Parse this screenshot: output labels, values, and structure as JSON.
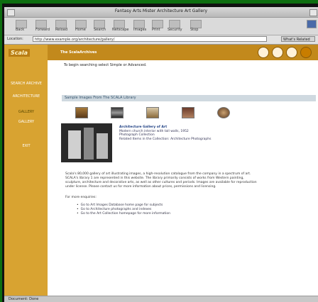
{
  "window": {
    "title": "Fantasy Arts  Mister Architecture  Art  Gallery"
  },
  "toolbar": {
    "buttons": [
      "Back",
      "Forward",
      "Reload",
      "Home",
      "Search",
      "Netscape",
      "Images",
      "Print",
      "Security",
      "Stop"
    ]
  },
  "location": {
    "label": "Location:",
    "url": "http://www.example.org/architecture/gallery/",
    "whats_related": "What's Related"
  },
  "sidebar": {
    "logo": "Scala",
    "links": [
      "SEARCH ARCHIVE",
      "ARCHITECTURE",
      "GALLERY",
      "EXIT"
    ],
    "active_index": 2
  },
  "header": {
    "section_title": "The ScalaArchives"
  },
  "page": {
    "intro": "To begin searching select Simple or Advanced.",
    "sample_title": "Sample Images From The SCALA Library",
    "feature": {
      "heading": "Architecture  Gallery of Art",
      "lines": [
        "Modern church interior with tall walls, 1952",
        "Photograph Collection",
        "Related Items in the Collection: Architecture Photographs"
      ]
    },
    "body": "Scala's 80,000 gallery of art illustrating images, a high-resolution catalogue from the company in a spectrum of art. SCALA's library 1 are represented in this website. The library primarily consists of works from Western painting, sculpture, architecture and decorative arts, as well as other cultures and periods. Images are available for reproduction under license. Please contact us for more information about prices, permissions and licensing.",
    "related_heading": "For more enquiries:",
    "related": [
      "Go to Art Images Database home page for subjects",
      "Go to Architecture photographs and indexes",
      "Go to the Art Collection homepage for more information"
    ]
  },
  "status": {
    "text": "Document: Done"
  }
}
